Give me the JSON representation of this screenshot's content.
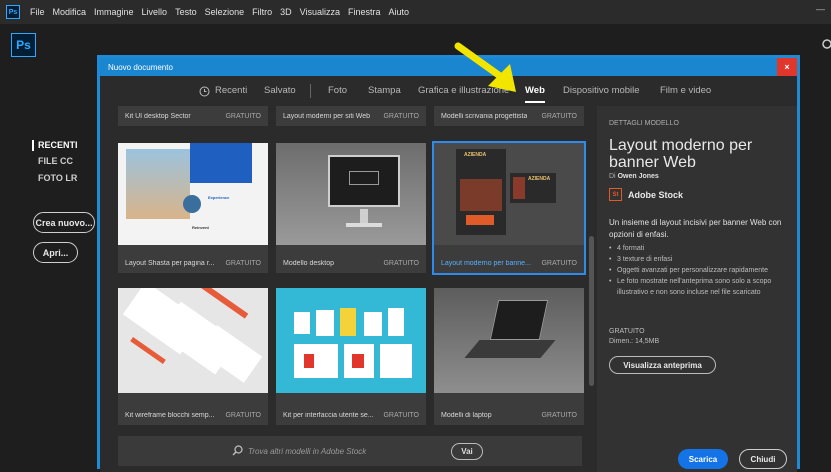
{
  "menubar": {
    "app_icon": "Ps",
    "items": [
      "File",
      "Modifica",
      "Immagine",
      "Livello",
      "Testo",
      "Selezione",
      "Filtro",
      "3D",
      "Visualizza",
      "Finestra",
      "Aiuto"
    ],
    "minimize": "—"
  },
  "app": {
    "logo": "Ps"
  },
  "leftnav": {
    "items": [
      "RECENTI",
      "FILE CC",
      "FOTO LR"
    ],
    "create_button": "Crea nuovo...",
    "open_button": "Apri..."
  },
  "dialog": {
    "title": "Nuovo documento",
    "close": "×",
    "tabs": [
      "Recenti",
      "Salvato",
      "Foto",
      "Stampa",
      "Grafica e illustrazione",
      "Web",
      "Dispositivo mobile",
      "Film e video"
    ],
    "active_tab": "Web",
    "templates": [
      {
        "label": "Kit UI desktop Sector",
        "price": "GRATUITO"
      },
      {
        "label": "Layout moderni per siti Web",
        "price": "GRATUITO"
      },
      {
        "label": "Modelli scrivania progettista",
        "price": "GRATUITO"
      },
      {
        "label": "Layout Shasta per pagina r...",
        "price": "GRATUITO"
      },
      {
        "label": "Modello desktop",
        "price": "GRATUITO"
      },
      {
        "label": "Layout moderno per banne...",
        "price": "GRATUITO"
      },
      {
        "label": "Kit wireframe blocchi semp...",
        "price": "GRATUITO"
      },
      {
        "label": "Kit per interfaccia utente se...",
        "price": "GRATUITO"
      },
      {
        "label": "Modelli di laptop",
        "price": "GRATUITO"
      }
    ],
    "thumb_text": {
      "shasta_1": "Experience",
      "shasta_2": "Reinvent",
      "banner_a": "AZIENDA",
      "banner_b": "AZIENDA"
    },
    "stock_search": {
      "placeholder": "Trova altri modelli in Adobe Stock",
      "button": "Vai"
    },
    "details": {
      "section": "DETTAGLI MODELLO",
      "title": "Layout moderno per banner Web",
      "author_prefix": "Di",
      "author": "Owen Jones",
      "stock_badge": "St",
      "stock_name": "Adobe Stock",
      "description": "Un insieme di layout incisivi per banner Web con opzioni di enfasi.",
      "bullets": [
        "4 formati",
        "3 texture di enfasi",
        "Oggetti avanzati per personalizzare rapidamente",
        "Le foto mostrate nell'anteprima sono solo a scopo illustrativo e non sono incluse nel file scaricato"
      ],
      "price": "GRATUITO",
      "size": "Dimen.: 14,5MB",
      "preview_button": "Visualizza anteprima"
    },
    "download_button": "Scarica",
    "close_button": "Chiudi"
  },
  "colors": {
    "accent": "#1a86d0",
    "primary_button": "#1473e6",
    "close": "#e0362c",
    "arrow": "#f2e600"
  }
}
